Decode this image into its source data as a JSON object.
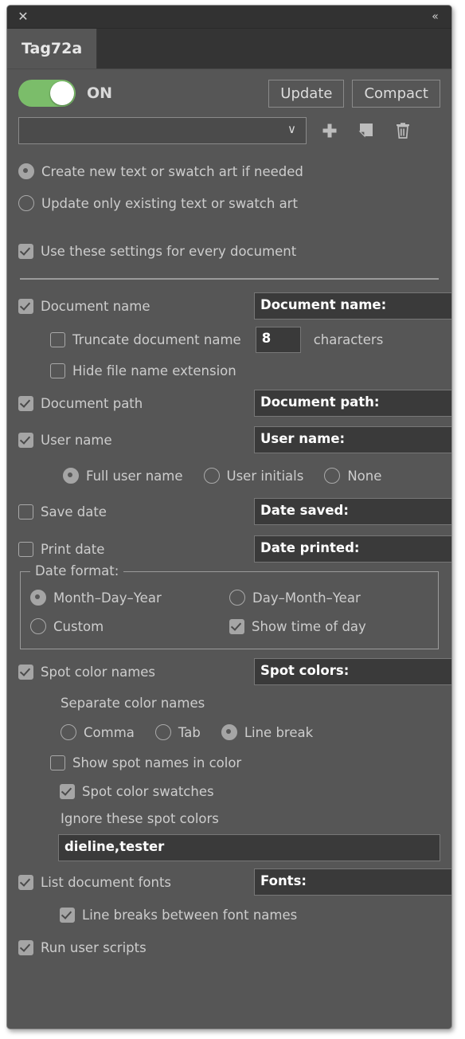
{
  "window": {
    "close_icon": "✕",
    "collapse_icon": "«"
  },
  "tabs": [
    {
      "label": "Tag72a",
      "active": true
    }
  ],
  "toolbar": {
    "toggle_state": "ON",
    "toggle_on": true,
    "toggle_color": "#7bbd6a",
    "update_label": "Update",
    "compact_label": "Compact"
  },
  "preset": {
    "value": "",
    "chevron": "∨",
    "add_icon": "plus-icon",
    "duplicate_icon": "duplicate-icon",
    "delete_icon": "trash-icon"
  },
  "mode": {
    "create_new_label": "Create new text or swatch art if needed",
    "create_new_selected": true,
    "update_only_label": "Update only existing text or swatch art",
    "update_only_selected": false,
    "every_document_label": "Use these settings for every document",
    "every_document_checked": true
  },
  "document_name": {
    "label": "Document name",
    "checked": true,
    "field_value": "Document name:",
    "truncate_label": "Truncate document name",
    "truncate_checked": false,
    "truncate_count": "8",
    "characters_label": "characters",
    "hide_extension_label": "Hide file name extension",
    "hide_extension_checked": false
  },
  "document_path": {
    "label": "Document path",
    "checked": true,
    "field_value": "Document path:"
  },
  "user_name": {
    "label": "User name",
    "checked": true,
    "field_value": "User name:",
    "options": [
      {
        "label": "Full user name",
        "selected": true
      },
      {
        "label": "User initials",
        "selected": false
      },
      {
        "label": "None",
        "selected": false
      }
    ]
  },
  "save_date": {
    "label": "Save date",
    "checked": false,
    "field_value": "Date saved:"
  },
  "print_date": {
    "label": "Print date",
    "checked": false,
    "field_value": "Date printed:"
  },
  "date_format": {
    "legend": "Date format:",
    "month_day_year": {
      "label": "Month–Day–Year",
      "selected": true
    },
    "day_month_year": {
      "label": "Day–Month–Year",
      "selected": false
    },
    "custom": {
      "label": "Custom",
      "selected": false
    },
    "show_time": {
      "label": "Show time of day",
      "checked": true
    }
  },
  "spot_colors": {
    "label": "Spot color names",
    "checked": true,
    "field_value": "Spot colors:",
    "separate_label": "Separate color names",
    "separators": [
      {
        "label": "Comma",
        "selected": false
      },
      {
        "label": "Tab",
        "selected": false
      },
      {
        "label": "Line break",
        "selected": true
      }
    ],
    "show_in_color_label": "Show spot names in color",
    "show_in_color_checked": false,
    "swatches_label": "Spot color swatches",
    "swatches_checked": true,
    "ignore_label": "Ignore these spot colors",
    "ignore_value": "dieline,tester"
  },
  "fonts": {
    "label": "List document fonts",
    "checked": true,
    "field_value": "Fonts:",
    "line_breaks_label": "Line breaks between font names",
    "line_breaks_checked": true
  },
  "scripts": {
    "label": "Run user scripts",
    "checked": true
  }
}
